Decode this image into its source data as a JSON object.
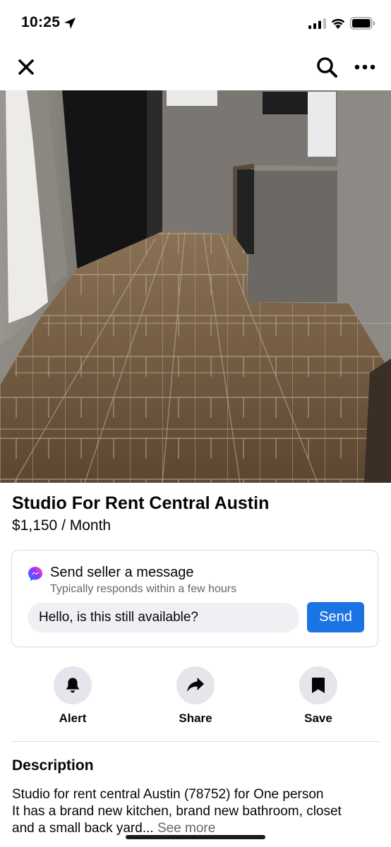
{
  "status_bar": {
    "time": "10:25"
  },
  "listing": {
    "photo_count": 10,
    "active_photo_index": 1,
    "title": "Studio For Rent Central Austin",
    "price": "$1,150 / Month"
  },
  "message_card": {
    "title": "Send seller a message",
    "subtitle": "Typically responds within a few hours",
    "input_value": "Hello, is this still available?",
    "send_label": "Send"
  },
  "actions": [
    {
      "label": "Alert",
      "icon": "bell-icon"
    },
    {
      "label": "Share",
      "icon": "share-arrow-icon"
    },
    {
      "label": "Save",
      "icon": "bookmark-icon"
    }
  ],
  "description": {
    "heading": "Description",
    "line1": "Studio for rent central Austin (78752) for One person",
    "line2": "It has a brand new kitchen, brand new bathroom, closet",
    "line3": "and a small back yard...",
    "see_more": "See more"
  },
  "colors": {
    "accent": "#1b74e4",
    "text": "#050505",
    "secondary_text": "#65676b",
    "icon_bg": "#e4e6eb"
  }
}
